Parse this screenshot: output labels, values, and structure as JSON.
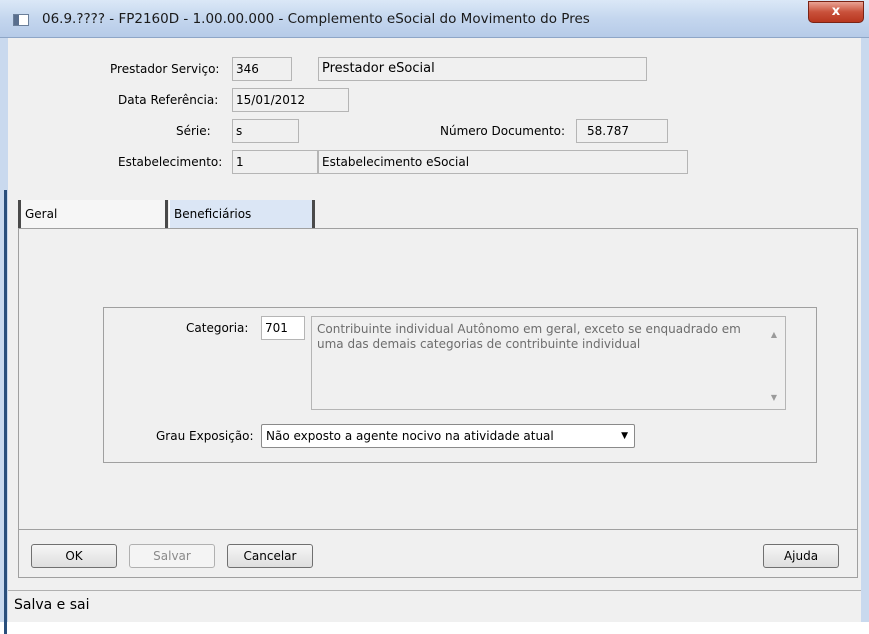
{
  "window": {
    "title": "06.9.???? - FP2160D - 1.00.00.000 - Complemento eSocial do Movimento do Pres",
    "close_glyph": "x"
  },
  "header": {
    "prestador_label": "Prestador Serviço:",
    "prestador_code": "346",
    "prestador_name": "Prestador eSocial",
    "data_label": "Data Referência:",
    "data_value": "15/01/2012",
    "serie_label": "Série:",
    "serie_value": "s",
    "numero_label": "Número Documento:",
    "numero_value": "58.787",
    "estab_label": "Estabelecimento:",
    "estab_code": "1",
    "estab_name": "Estabelecimento eSocial"
  },
  "tabs": [
    {
      "label": "Geral",
      "active": true
    },
    {
      "label": "Beneficiários",
      "active": false
    }
  ],
  "geral": {
    "categoria_label": "Categoria:",
    "categoria_value": "701",
    "categoria_desc": "Contribuinte individual  Autônomo em geral, exceto se enquadrado em uma das demais categorias de contribuinte individual",
    "grau_label": "Grau Exposição:",
    "grau_value": "Não exposto a agente nocivo na atividade atual"
  },
  "buttons": {
    "ok": "OK",
    "salvar": "Salvar",
    "cancelar": "Cancelar",
    "ajuda": "Ajuda"
  },
  "status": {
    "text": "Salva e sai"
  },
  "icons": {
    "window": "window-icon",
    "scroll_up": "scroll-up-icon",
    "scroll_down": "scroll-down-icon",
    "dropdown": "chevron-down-icon"
  }
}
